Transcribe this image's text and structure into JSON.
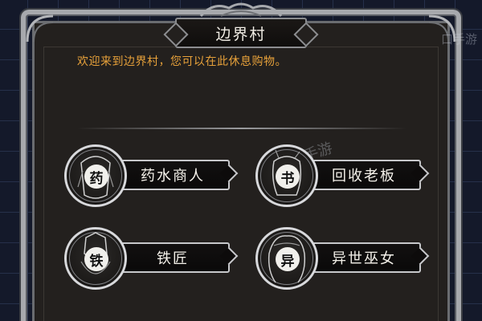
{
  "location": {
    "title": "边界村",
    "welcome": "欢迎来到边界村，您可以在此休息购物。"
  },
  "npcs": [
    {
      "label": "药水商人",
      "seal": "药"
    },
    {
      "label": "回收老板",
      "seal": "书"
    },
    {
      "label": "铁匠",
      "seal": "铁"
    },
    {
      "label": "异世巫女",
      "seal": "异"
    }
  ],
  "watermark": {
    "text": "口手游",
    "overlay": "口手游"
  },
  "colors": {
    "background": "#14192a",
    "panel": "#23201e",
    "frame": "#a7a9ad",
    "welcome_text": "#e7a13a",
    "label_text": "#f4f1ea"
  },
  "icons": [
    "portrait-medallion-icon",
    "ornament-icon",
    "divider-ornament"
  ]
}
